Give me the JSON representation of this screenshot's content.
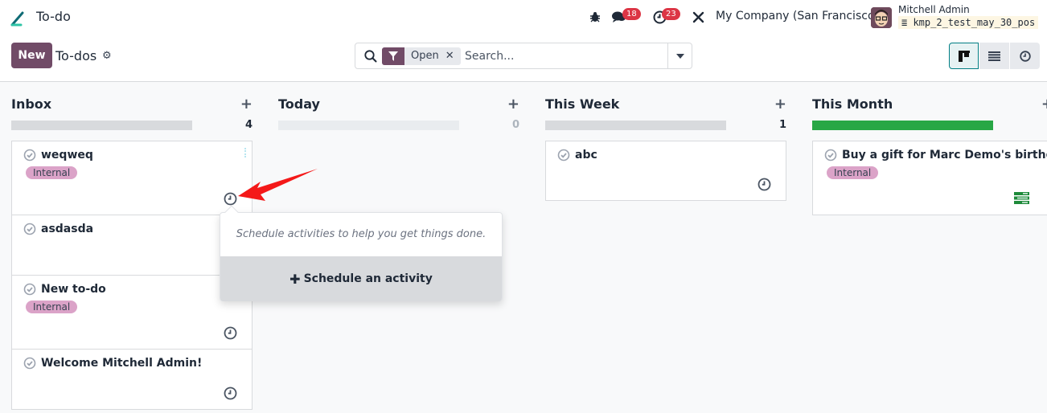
{
  "topbar": {
    "app_name": "To-do",
    "messages_count": "18",
    "activities_count": "23",
    "company": "My Company (San Francisco)",
    "user_name": "Mitchell Admin",
    "database": "kmp_2_test_may_30_pos"
  },
  "control": {
    "new_label": "New",
    "title": "To-dos",
    "search_placeholder": "Search...",
    "facet_label": "Open",
    "views": [
      "kanban",
      "list",
      "activity"
    ]
  },
  "columns": [
    {
      "title": "Inbox",
      "count": "4",
      "cards": [
        {
          "title": "weqweq",
          "tag": "Internal",
          "activity": "clock"
        },
        {
          "title": "asdasda",
          "tag": null,
          "activity": "clock"
        },
        {
          "title": "New to-do",
          "tag": "Internal",
          "activity": "clock"
        },
        {
          "title": "Welcome Mitchell Admin!",
          "tag": null,
          "activity": "clock"
        }
      ]
    },
    {
      "title": "Today",
      "count": "0",
      "cards": []
    },
    {
      "title": "This Week",
      "count": "1",
      "cards": [
        {
          "title": "abc",
          "tag": null,
          "activity": "clock"
        }
      ]
    },
    {
      "title": "This Month",
      "count": "",
      "progress_color": "#28a745",
      "progress_fraction": 1.0,
      "cards": [
        {
          "title": "Buy a gift for Marc Demo's birthday",
          "tag": "Internal",
          "activity": "planned-ok"
        }
      ]
    }
  ],
  "popover": {
    "text": "Schedule activities to help you get things done.",
    "button_label": "Schedule an activity"
  },
  "colors": {
    "brand": "#714b67",
    "tag": "#dba3c8",
    "success": "#28a745",
    "badge": "#dc3545"
  }
}
